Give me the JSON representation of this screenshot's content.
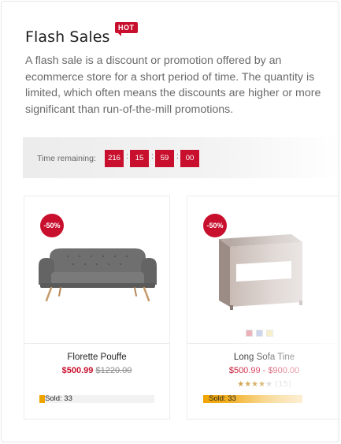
{
  "header": {
    "title": "Flash Sales",
    "hot_badge": "HOT",
    "description": "A flash sale is a discount or promotion offered by an ecommerce store for a short period of time. The quantity is limited, which often means the discounts are higher or more significant than run-of-the-mill promotions."
  },
  "timer": {
    "label": "Time remaining:",
    "days": "216",
    "hours": "15",
    "minutes": "59",
    "seconds": "00",
    "separator": ":"
  },
  "products": [
    {
      "discount": "-50%",
      "name": "Florette Pouffe",
      "price_new": "$500.99",
      "price_old": "$1220.00",
      "sold_label": "Sold: 33",
      "sold_fraction": 0.05,
      "image_icon": "sofa-icon"
    },
    {
      "discount": "-50%",
      "name": "Long Sofa Tine",
      "price_new": "$500.99",
      "price_sep": "-",
      "price_old": "$900.00",
      "rating_count": "(15)",
      "stars_filled": 4,
      "stars_total": 5,
      "sold_label": "Sold: 33",
      "sold_fraction": 1.0,
      "image_icon": "nightstand-icon",
      "swatches": [
        "#e8a0a8",
        "#b8c4e4",
        "#f0e6a8"
      ]
    }
  ],
  "colors": {
    "accent": "#c8102e",
    "sold_bar": "#f0a400"
  }
}
